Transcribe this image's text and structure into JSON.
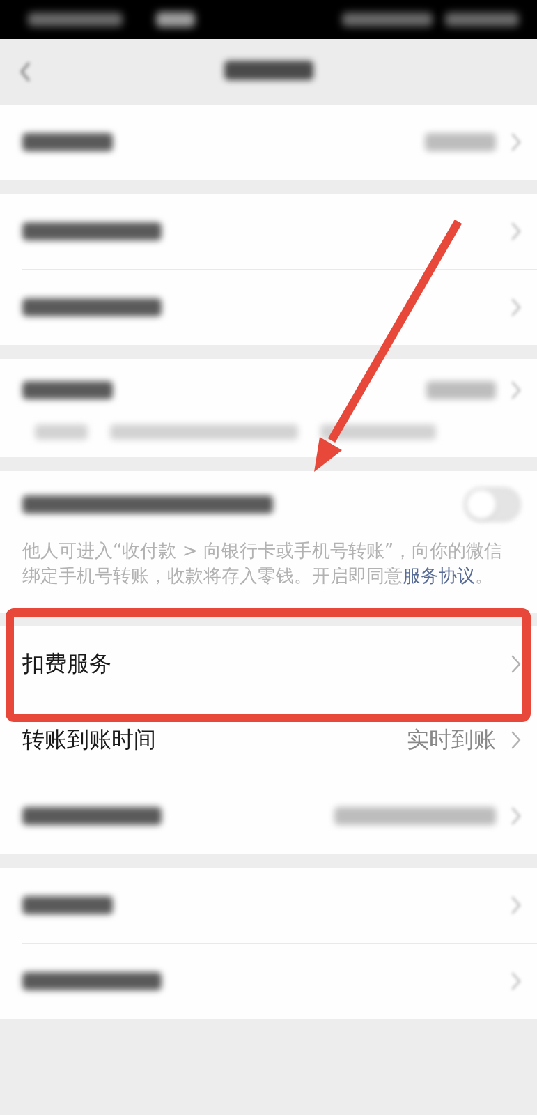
{
  "status_bar": {
    "redacted": true
  },
  "nav_bar": {
    "back": true,
    "title_redacted": true
  },
  "sections": [
    {
      "rows": [
        {
          "kind": "redacted",
          "value_redacted": true,
          "chevron": true
        }
      ]
    },
    {
      "rows": [
        {
          "kind": "redacted",
          "value_redacted": false,
          "chevron": true
        },
        {
          "kind": "redacted",
          "value_redacted": false,
          "chevron": true
        }
      ]
    },
    {
      "rows": [
        {
          "kind": "redacted",
          "value_redacted": true,
          "chevron": true,
          "note_redacted": true
        }
      ]
    },
    {
      "rows": [
        {
          "kind": "redacted_toggle",
          "on": false,
          "note": {
            "text": "他人可进入“收付款 > 向银行卡或手机号转账”，向你的微信绑定手机号转账，收款将存入零钱。开启即同意",
            "link": "服务协议",
            "end": "。"
          }
        }
      ]
    },
    {
      "rows": [
        {
          "kind": "link",
          "label": "扣费服务",
          "chevron": true,
          "highlighted": true
        },
        {
          "kind": "link",
          "label": "转账到账时间",
          "value": "实时到账",
          "chevron": true,
          "highlighted": false
        },
        {
          "kind": "redacted",
          "value_redacted": true,
          "chevron": true,
          "highlighted": false
        }
      ]
    },
    {
      "rows": [
        {
          "kind": "redacted",
          "value_redacted": false,
          "chevron": true
        },
        {
          "kind": "redacted",
          "value_redacted": false,
          "chevron": true
        }
      ]
    }
  ],
  "annotations": [
    {
      "kind": "arrow"
    }
  ]
}
